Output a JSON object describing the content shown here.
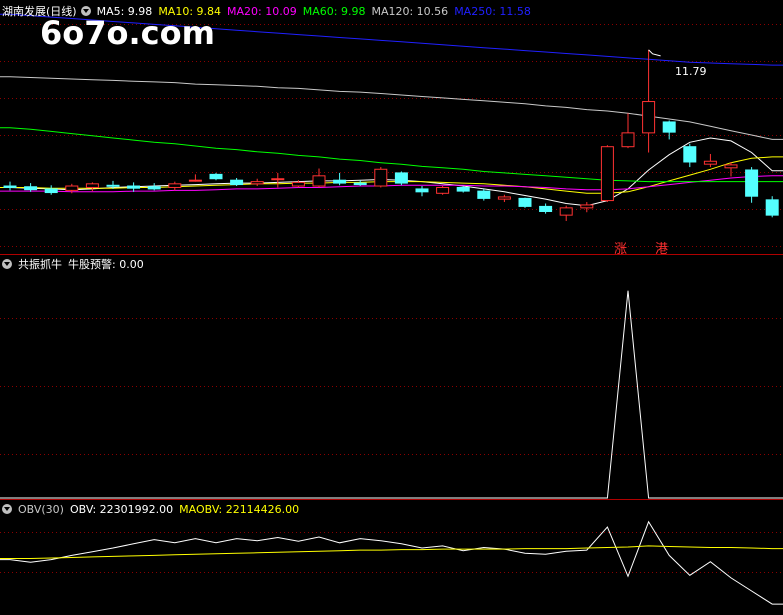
{
  "watermark": "6o7o.com",
  "panels": {
    "price": {
      "title": "湖南发展(日线)",
      "ma_items": [
        {
          "label": "MA5: 9.98",
          "color": "#ffffff"
        },
        {
          "label": "MA10: 9.84",
          "color": "#ffff00"
        },
        {
          "label": "MA20: 10.09",
          "color": "#ff00ff"
        },
        {
          "label": "MA60: 9.98",
          "color": "#00ff00"
        },
        {
          "label": "MA120: 10.56",
          "color": "#c8c8c8"
        },
        {
          "label": "MA250: 11.58",
          "color": "#2020ff"
        }
      ],
      "high_label": "11.79",
      "signal_up": "涨",
      "signal_port": "港"
    },
    "indicator": {
      "title": "共振抓牛",
      "value_label": "牛股预警: 0.00"
    },
    "obv": {
      "title": "OBV(30)",
      "obv_label": "OBV: 22301992.00",
      "maobv_label": "MAOBV: 22114426.00"
    }
  },
  "colors": {
    "up": "#ff3232",
    "down": "#54ffff",
    "grid": "#8b0000",
    "divider": "#b00000"
  },
  "chart_data": [
    {
      "type": "candlestick",
      "title": "湖南发展(日线)",
      "ylim": [
        9.0,
        12.2
      ],
      "candles": [
        {
          "o": 9.92,
          "h": 9.98,
          "l": 9.86,
          "c": 9.9
        },
        {
          "o": 9.91,
          "h": 9.96,
          "l": 9.84,
          "c": 9.87
        },
        {
          "o": 9.88,
          "h": 9.93,
          "l": 9.8,
          "c": 9.83
        },
        {
          "o": 9.86,
          "h": 9.95,
          "l": 9.82,
          "c": 9.92
        },
        {
          "o": 9.9,
          "h": 9.97,
          "l": 9.85,
          "c": 9.95
        },
        {
          "o": 9.93,
          "h": 9.99,
          "l": 9.88,
          "c": 9.92
        },
        {
          "o": 9.92,
          "h": 9.97,
          "l": 9.84,
          "c": 9.89
        },
        {
          "o": 9.91,
          "h": 9.96,
          "l": 9.86,
          "c": 9.88
        },
        {
          "o": 9.9,
          "h": 9.98,
          "l": 9.86,
          "c": 9.95
        },
        {
          "o": 10.0,
          "h": 10.08,
          "l": 9.98,
          "c": 10.0
        },
        {
          "o": 10.08,
          "h": 10.1,
          "l": 10.0,
          "c": 10.02
        },
        {
          "o": 10.0,
          "h": 10.03,
          "l": 9.92,
          "c": 9.94
        },
        {
          "o": 9.95,
          "h": 10.02,
          "l": 9.92,
          "c": 9.98
        },
        {
          "o": 10.02,
          "h": 10.1,
          "l": 9.9,
          "c": 10.02
        },
        {
          "o": 9.92,
          "h": 10.0,
          "l": 9.9,
          "c": 9.97
        },
        {
          "o": 9.92,
          "h": 10.16,
          "l": 9.9,
          "c": 10.06
        },
        {
          "o": 10.0,
          "h": 10.1,
          "l": 9.93,
          "c": 9.96
        },
        {
          "o": 9.96,
          "h": 10.0,
          "l": 9.92,
          "c": 9.94
        },
        {
          "o": 9.92,
          "h": 10.18,
          "l": 9.9,
          "c": 10.15
        },
        {
          "o": 10.1,
          "h": 10.12,
          "l": 9.93,
          "c": 9.96
        },
        {
          "o": 9.88,
          "h": 9.92,
          "l": 9.78,
          "c": 9.84
        },
        {
          "o": 9.82,
          "h": 9.92,
          "l": 9.8,
          "c": 9.9
        },
        {
          "o": 9.9,
          "h": 9.92,
          "l": 9.83,
          "c": 9.85
        },
        {
          "o": 9.85,
          "h": 9.88,
          "l": 9.72,
          "c": 9.75
        },
        {
          "o": 9.74,
          "h": 9.8,
          "l": 9.7,
          "c": 9.77
        },
        {
          "o": 9.75,
          "h": 9.76,
          "l": 9.62,
          "c": 9.64
        },
        {
          "o": 9.64,
          "h": 9.68,
          "l": 9.54,
          "c": 9.57
        },
        {
          "o": 9.52,
          "h": 9.65,
          "l": 9.44,
          "c": 9.62
        },
        {
          "o": 9.62,
          "h": 9.7,
          "l": 9.56,
          "c": 9.66
        },
        {
          "o": 9.72,
          "h": 10.48,
          "l": 9.7,
          "c": 10.46
        },
        {
          "o": 10.46,
          "h": 10.92,
          "l": 10.44,
          "c": 10.65
        },
        {
          "o": 10.65,
          "h": 11.79,
          "l": 10.38,
          "c": 11.08
        },
        {
          "o": 10.8,
          "h": 10.82,
          "l": 10.56,
          "c": 10.66
        },
        {
          "o": 10.46,
          "h": 10.5,
          "l": 10.18,
          "c": 10.25
        },
        {
          "o": 10.22,
          "h": 10.36,
          "l": 10.18,
          "c": 10.26
        },
        {
          "o": 10.17,
          "h": 10.25,
          "l": 10.05,
          "c": 10.21
        },
        {
          "o": 10.14,
          "h": 10.18,
          "l": 9.69,
          "c": 9.78
        },
        {
          "o": 9.73,
          "h": 9.78,
          "l": 9.49,
          "c": 9.52
        }
      ],
      "ma": {
        "MA5": [
          9.9,
          9.89,
          9.88,
          9.87,
          9.88,
          9.9,
          9.91,
          9.92,
          9.93,
          9.94,
          9.95,
          9.96,
          9.96,
          9.97,
          9.98,
          9.99,
          9.99,
          10.0,
          10.01,
          10.0,
          9.98,
          9.95,
          9.92,
          9.88,
          9.84,
          9.79,
          9.74,
          9.68,
          9.65,
          9.72,
          9.88,
          10.14,
          10.35,
          10.52,
          10.58,
          10.54,
          10.38,
          10.13
        ],
        "MA10": [
          9.9,
          9.9,
          9.89,
          9.89,
          9.89,
          9.89,
          9.9,
          9.9,
          9.91,
          9.92,
          9.93,
          9.94,
          9.95,
          9.95,
          9.96,
          9.96,
          9.97,
          9.97,
          9.98,
          9.98,
          9.98,
          9.97,
          9.96,
          9.95,
          9.93,
          9.91,
          9.88,
          9.85,
          9.82,
          9.82,
          9.84,
          9.91,
          9.99,
          10.07,
          10.15,
          10.24,
          10.3,
          10.32
        ],
        "MA20": [
          9.85,
          9.85,
          9.85,
          9.84,
          9.84,
          9.84,
          9.85,
          9.85,
          9.86,
          9.86,
          9.87,
          9.88,
          9.88,
          9.89,
          9.9,
          9.9,
          9.91,
          9.92,
          9.92,
          9.93,
          9.93,
          9.93,
          9.93,
          9.92,
          9.92,
          9.91,
          9.9,
          9.88,
          9.87,
          9.87,
          9.88,
          9.91,
          9.94,
          9.97,
          10.0,
          10.03,
          10.05,
          10.06
        ],
        "MA60": [
          10.72,
          10.7,
          10.67,
          10.64,
          10.61,
          10.58,
          10.55,
          10.52,
          10.5,
          10.47,
          10.44,
          10.42,
          10.39,
          10.37,
          10.34,
          10.32,
          10.29,
          10.27,
          10.24,
          10.22,
          10.19,
          10.17,
          10.15,
          10.12,
          10.1,
          10.08,
          10.06,
          10.04,
          10.02,
          10.0,
          9.99,
          9.98,
          9.98,
          9.98,
          9.98,
          9.98,
          9.98,
          9.98
        ],
        "MA120": [
          11.42,
          11.41,
          11.4,
          11.39,
          11.38,
          11.37,
          11.36,
          11.35,
          11.34,
          11.32,
          11.31,
          11.3,
          11.29,
          11.27,
          11.26,
          11.24,
          11.22,
          11.21,
          11.19,
          11.17,
          11.15,
          11.13,
          11.11,
          11.09,
          11.07,
          11.05,
          11.02,
          11.0,
          10.97,
          10.95,
          10.92,
          10.88,
          10.84,
          10.8,
          10.74,
          10.68,
          10.62,
          10.56
        ],
        "MA250": [
          12.28,
          12.26,
          12.24,
          12.22,
          12.2,
          12.18,
          12.16,
          12.14,
          12.12,
          12.1,
          12.08,
          12.06,
          12.04,
          12.02,
          12.0,
          11.98,
          11.96,
          11.94,
          11.92,
          11.9,
          11.88,
          11.86,
          11.84,
          11.82,
          11.8,
          11.78,
          11.76,
          11.74,
          11.72,
          11.7,
          11.68,
          11.66,
          11.64,
          11.62,
          11.61,
          11.6,
          11.59,
          11.58
        ]
      },
      "annotations": [
        {
          "index": 31,
          "text": "11.79"
        }
      ]
    },
    {
      "type": "line",
      "title": "共振抓牛",
      "series": [
        {
          "name": "牛股预警",
          "values": [
            0,
            0,
            0,
            0,
            0,
            0,
            0,
            0,
            0,
            0,
            0,
            0,
            0,
            0,
            0,
            0,
            0,
            0,
            0,
            0,
            0,
            0,
            0,
            0,
            0,
            0,
            0,
            0,
            0,
            0,
            1,
            0,
            0,
            0,
            0,
            0,
            0,
            0
          ]
        }
      ],
      "ylim": [
        0,
        1.1
      ]
    },
    {
      "type": "line",
      "title": "OBV(30)",
      "series": [
        {
          "name": "OBV",
          "values": [
            21.9,
            21.85,
            21.9,
            21.98,
            22.05,
            22.12,
            22.2,
            22.28,
            22.22,
            22.3,
            22.22,
            22.3,
            22.26,
            22.32,
            22.25,
            22.33,
            22.22,
            22.3,
            22.26,
            22.2,
            22.12,
            22.16,
            22.07,
            22.13,
            22.1,
            22.02,
            22.0,
            22.06,
            22.08,
            22.52,
            21.58,
            22.62,
            21.98,
            21.6,
            21.86,
            21.55,
            21.3,
            21.05
          ]
        },
        {
          "name": "MAOBV",
          "values": [
            21.92,
            21.92,
            21.93,
            21.94,
            21.95,
            21.96,
            21.97,
            21.98,
            21.99,
            22.0,
            22.01,
            22.02,
            22.03,
            22.04,
            22.05,
            22.06,
            22.07,
            22.08,
            22.08,
            22.09,
            22.09,
            22.1,
            22.1,
            22.1,
            22.1,
            22.11,
            22.11,
            22.11,
            22.12,
            22.13,
            22.14,
            22.16,
            22.15,
            22.14,
            22.13,
            22.13,
            22.12,
            22.11
          ]
        }
      ],
      "unit": "million"
    }
  ]
}
